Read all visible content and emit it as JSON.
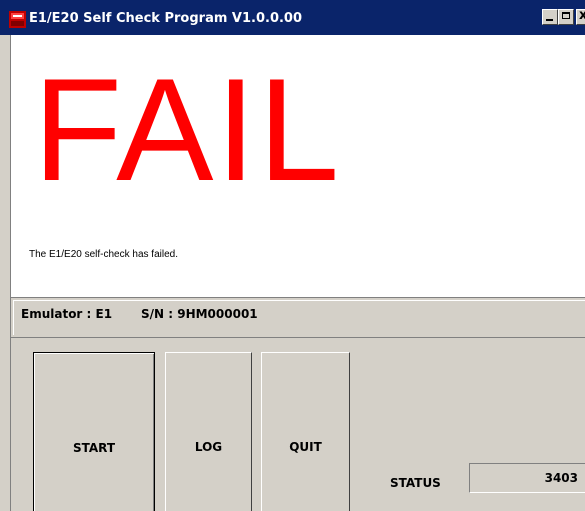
{
  "window": {
    "title": "E1/E20 Self Check Program V1.0.0.00",
    "icon": "e1-e20-app-icon",
    "controls": {
      "minimize_icon": "minimize-icon",
      "maximize_icon": "maximize-icon",
      "close_icon": "close-icon",
      "close_glyph": "x"
    },
    "title_bar_color": "#0a246a"
  },
  "result": {
    "headline": "FAIL",
    "headline_color": "#ff0000",
    "message": "The E1/E20 self-check has failed."
  },
  "info": {
    "emulator_label": "Emulator : E1",
    "serial_label": "S/N : 9HM000001"
  },
  "buttons": {
    "start": "START",
    "log": "LOG",
    "quit": "QUIT"
  },
  "status": {
    "label": "STATUS",
    "value": "3403"
  }
}
